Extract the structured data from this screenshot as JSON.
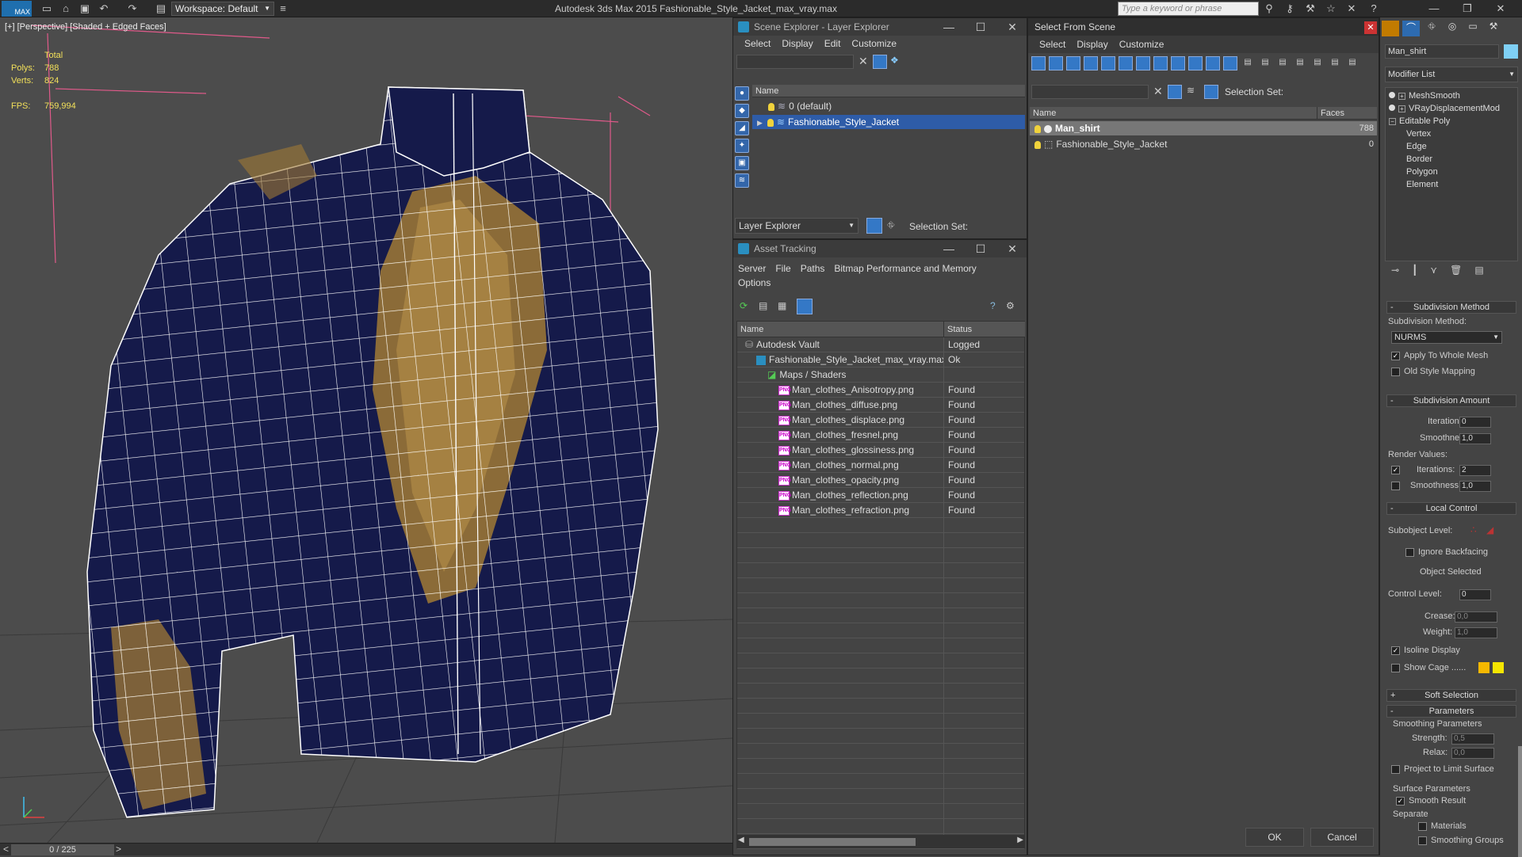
{
  "titlebar": {
    "workspace": "Workspace: Default",
    "app_title": "Autodesk 3ds Max  2015      Fashionable_Style_Jacket_max_vray.max",
    "search_placeholder": "Type a keyword or phrase",
    "logo": "MAX"
  },
  "viewport": {
    "label": "[+] [Perspective] [Shaded + Edged Faces]",
    "stats": {
      "total_label": "Total",
      "polys_label": "Polys:",
      "polys": "788",
      "verts_label": "Verts:",
      "verts": "824",
      "fps_label": "FPS:",
      "fps": "759,994"
    }
  },
  "bottombar": {
    "timeslider": "0 / 225",
    "prev": "<",
    "next": ">"
  },
  "scene_explorer": {
    "title": "Scene Explorer - Layer Explorer",
    "menus": [
      "Select",
      "Display",
      "Edit",
      "Customize"
    ],
    "col_name": "Name",
    "layers": [
      "0 (default)",
      "Fashionable_Style_Jacket"
    ],
    "footer_dropdown": "Layer Explorer",
    "selection_set": "Selection Set:"
  },
  "asset_tracking": {
    "title": "Asset Tracking",
    "menus": [
      "Server",
      "File",
      "Paths",
      "Bitmap Performance and Memory"
    ],
    "menu2": "Options",
    "col_name": "Name",
    "col_status": "Status",
    "rows": [
      {
        "name": "Autodesk Vault",
        "status": "Logged",
        "indent": 0
      },
      {
        "name": "Fashionable_Style_Jacket_max_vray.max",
        "status": "Ok",
        "indent": 1
      },
      {
        "name": "Maps / Shaders",
        "status": "",
        "indent": 2
      },
      {
        "name": "Man_clothes_Anisotropy.png",
        "status": "Found",
        "indent": 3
      },
      {
        "name": "Man_clothes_diffuse.png",
        "status": "Found",
        "indent": 3
      },
      {
        "name": "Man_clothes_displace.png",
        "status": "Found",
        "indent": 3
      },
      {
        "name": "Man_clothes_fresnel.png",
        "status": "Found",
        "indent": 3
      },
      {
        "name": "Man_clothes_glossiness.png",
        "status": "Found",
        "indent": 3
      },
      {
        "name": "Man_clothes_normal.png",
        "status": "Found",
        "indent": 3
      },
      {
        "name": "Man_clothes_opacity.png",
        "status": "Found",
        "indent": 3
      },
      {
        "name": "Man_clothes_reflection.png",
        "status": "Found",
        "indent": 3
      },
      {
        "name": "Man_clothes_refraction.png",
        "status": "Found",
        "indent": 3
      }
    ]
  },
  "select_from_scene": {
    "title": "Select From Scene",
    "menus": [
      "Select",
      "Display",
      "Customize"
    ],
    "selection_set": "Selection Set:",
    "col_name": "Name",
    "col_faces": "Faces",
    "rows": [
      {
        "name": "Man_shirt",
        "faces": "788"
      },
      {
        "name": "Fashionable_Style_Jacket",
        "faces": "0"
      }
    ],
    "ok": "OK",
    "cancel": "Cancel"
  },
  "command_panel": {
    "object_name": "Man_shirt",
    "modifier_list": "Modifier List",
    "stack": [
      "MeshSmooth",
      "VRayDisplacementMod",
      "Editable Poly",
      "Vertex",
      "Edge",
      "Border",
      "Polygon",
      "Element"
    ],
    "subdivision_method": {
      "header": "Subdivision Method",
      "label": "Subdivision Method:",
      "value": "NURMS",
      "apply_whole": "Apply To Whole Mesh",
      "old_style": "Old Style Mapping"
    },
    "subdivision_amount": {
      "header": "Subdivision Amount",
      "iterations_label": "Iterations:",
      "iterations": "0",
      "smoothness_label": "Smoothness:",
      "smoothness": "1,0",
      "render_values": "Render Values:",
      "r_iterations_label": "Iterations:",
      "r_iterations": "2",
      "r_smoothness_label": "Smoothness:",
      "r_smoothness": "1,0"
    },
    "local_control": {
      "header": "Local Control",
      "subobject": "Subobject Level:",
      "ignore_backfacing": "Ignore Backfacing",
      "object_selected": "Object Selected",
      "control_level_label": "Control Level:",
      "control_level": "0",
      "crease_label": "Crease:",
      "crease": "0,0",
      "weight_label": "Weight:",
      "weight": "1,0",
      "isoline": "Isoline Display",
      "show_cage": "Show Cage ......"
    },
    "soft_selection": {
      "header": "Soft Selection"
    },
    "parameters": {
      "header": "Parameters",
      "smoothing": "Smoothing Parameters",
      "strength_label": "Strength:",
      "strength": "0,5",
      "relax_label": "Relax:",
      "relax": "0,0",
      "project": "Project to Limit Surface",
      "surface": "Surface Parameters",
      "smooth_result": "Smooth Result",
      "separate": "Separate",
      "materials": "Materials",
      "smoothing_groups": "Smoothing Groups"
    },
    "expand_minus": "-",
    "expand_plus": "+",
    "colors": {
      "cage1": "#f5b800",
      "cage2": "#f5e600"
    }
  },
  "colors": {
    "shirt": "#141847",
    "pattern": "#a07a35",
    "selection": "#2e5ca8"
  }
}
